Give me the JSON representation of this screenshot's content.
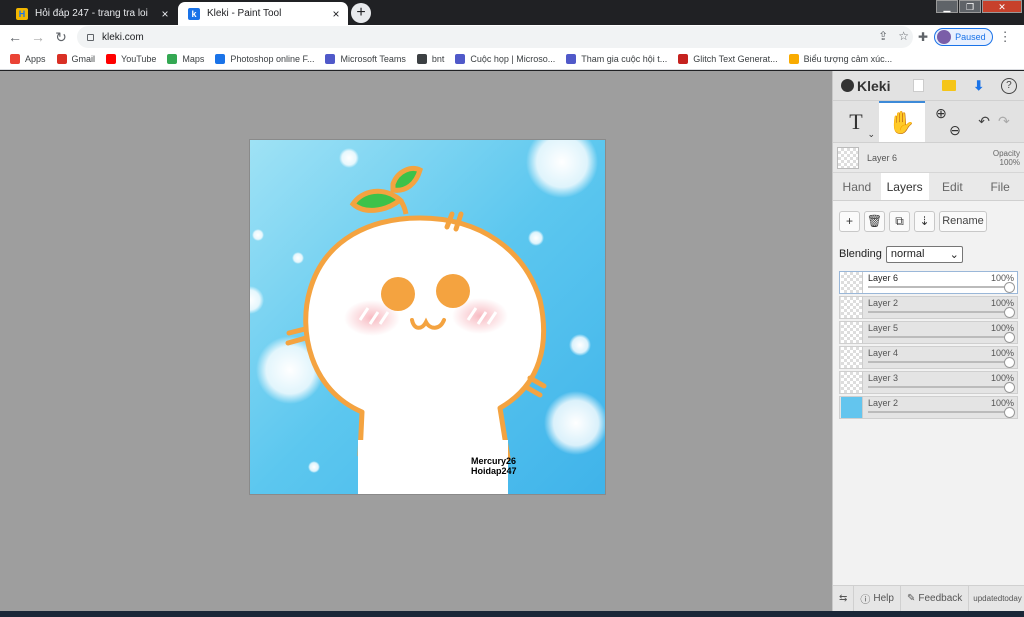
{
  "browser": {
    "tabs": [
      {
        "title": "Hỏi đáp 247 - trang tra loi",
        "close": "×"
      },
      {
        "title": "Kleki - Paint Tool",
        "close": "×"
      }
    ],
    "new_tab": "+",
    "url": "kleki.com",
    "profile_label": "Paused",
    "back": "←",
    "forward": "→",
    "reload": "↻"
  },
  "bookmarks": [
    {
      "label": "Apps",
      "color": "#ea4335"
    },
    {
      "label": "Gmail",
      "color": "#d93025"
    },
    {
      "label": "YouTube",
      "color": "#ff0000"
    },
    {
      "label": "Maps",
      "color": "#34a853"
    },
    {
      "label": "Photoshop online F...",
      "color": "#1a73e8"
    },
    {
      "label": "Microsoft Teams",
      "color": "#5059c9"
    },
    {
      "label": "bnt",
      "color": "#3c4043"
    },
    {
      "label": "Cuộc họp | Microso...",
      "color": "#5059c9"
    },
    {
      "label": "Tham gia cuộc hội t...",
      "color": "#5059c9"
    },
    {
      "label": "Glitch Text Generat...",
      "color": "#c5221f"
    },
    {
      "label": "Biểu tượng cảm xúc...",
      "color": "#f9ab00"
    }
  ],
  "canvas": {
    "signature_line1": "Mercury26",
    "signature_line2": "Hoidap247"
  },
  "kleki": {
    "logo": "Kleki",
    "help": "?",
    "tool_text": "T",
    "tool_text_sub": "⌄",
    "zoom_in": "⊕",
    "zoom_out": "⊖",
    "undo": "↶",
    "redo": "↷",
    "current_layer": "Layer 6",
    "opacity_label": "Opacity",
    "opacity_value": "100%",
    "tabs": [
      "Hand",
      "Layers",
      "Edit",
      "File"
    ],
    "actions": {
      "add": "+",
      "delete": "🗑",
      "duplicate": "⧉",
      "merge": "⇣",
      "rename": "Rename"
    },
    "blending_label": "Blending",
    "blending_value": "normal",
    "layers": [
      {
        "name": "Layer 6",
        "opacity": "100%",
        "selected": true
      },
      {
        "name": "Layer 2",
        "opacity": "100%",
        "selected": false
      },
      {
        "name": "Layer 5",
        "opacity": "100%",
        "selected": false
      },
      {
        "name": "Layer 4",
        "opacity": "100%",
        "selected": false
      },
      {
        "name": "Layer 3",
        "opacity": "100%",
        "selected": false
      },
      {
        "name": "Layer 2",
        "opacity": "100%",
        "selected": false
      }
    ],
    "footer": {
      "swap": "⇆",
      "help": "Help",
      "feedback": "Feedback",
      "updated_line1": "updated",
      "updated_line2": "today"
    }
  }
}
